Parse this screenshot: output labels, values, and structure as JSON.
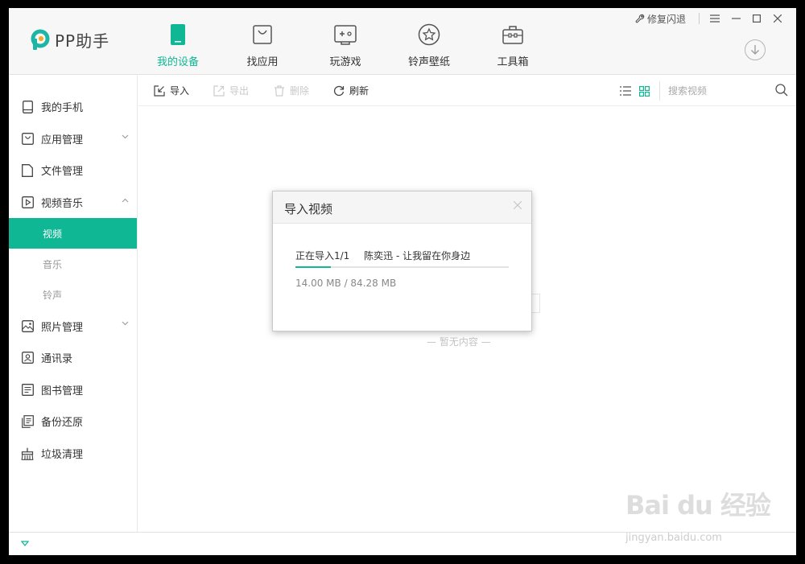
{
  "app": {
    "name": "PP助手"
  },
  "nav": [
    {
      "label": "我的设备",
      "icon": "phone-icon",
      "active": true
    },
    {
      "label": "找应用",
      "icon": "bag-icon",
      "active": false
    },
    {
      "label": "玩游戏",
      "icon": "gamepad-icon",
      "active": false
    },
    {
      "label": "铃声壁纸",
      "icon": "star-icon",
      "active": false
    },
    {
      "label": "工具箱",
      "icon": "toolbox-icon",
      "active": false
    }
  ],
  "window": {
    "repair_label": "修复闪退"
  },
  "sidebar": {
    "items": [
      {
        "label": "我的手机",
        "icon": "phone-icon"
      },
      {
        "label": "应用管理",
        "icon": "bag-icon"
      },
      {
        "label": "文件管理",
        "icon": "folder-icon"
      },
      {
        "label": "视频音乐",
        "icon": "play-icon"
      },
      {
        "label": "照片管理",
        "icon": "image-icon"
      },
      {
        "label": "通讯录",
        "icon": "contacts-icon"
      },
      {
        "label": "图书管理",
        "icon": "book-icon"
      },
      {
        "label": "备份还原",
        "icon": "backup-icon"
      },
      {
        "label": "垃圾清理",
        "icon": "broom-icon"
      }
    ],
    "sub_items": [
      {
        "label": "视频",
        "active": true
      },
      {
        "label": "音乐",
        "active": false
      },
      {
        "label": "铃声",
        "active": false
      }
    ]
  },
  "toolbar": {
    "import_label": "导入",
    "export_label": "导出",
    "delete_label": "删除",
    "refresh_label": "刷新",
    "search_placeholder": "搜索视频"
  },
  "content": {
    "empty_text": "— 暂无内容 —"
  },
  "dialog": {
    "title": "导入视频",
    "status": "正在导入1/1",
    "song": "陈奕迅 - 让我留在你身边",
    "size": "14.00 MB / 84.28 MB",
    "progress": 0.166
  },
  "watermark": {
    "main": "Bai du 经验",
    "sub": "jingyan.baidu.com"
  },
  "colors": {
    "accent": "#10b795"
  }
}
